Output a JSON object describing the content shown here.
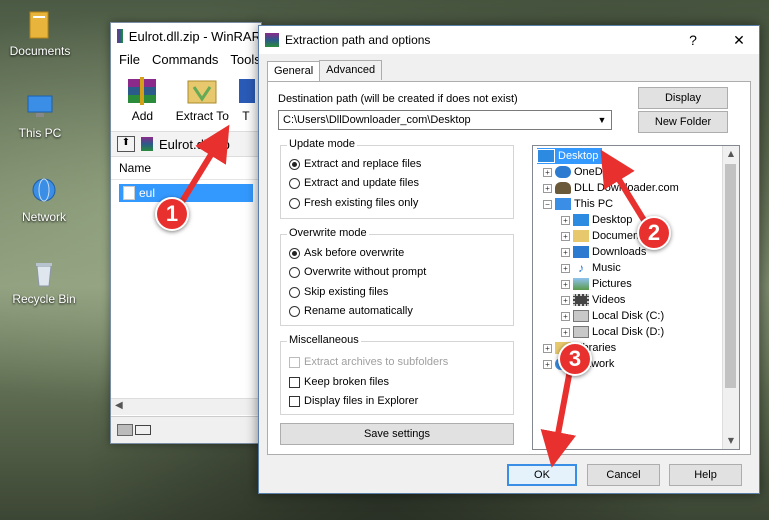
{
  "desktop": {
    "icons": [
      {
        "label": "Documents"
      },
      {
        "label": "This PC"
      },
      {
        "label": "Network"
      },
      {
        "label": "Recycle Bin"
      }
    ]
  },
  "winrar": {
    "title": "Eulrot.dll.zip - WinRAR",
    "menu": [
      "File",
      "Commands",
      "Tools"
    ],
    "toolbar": {
      "add": "Add",
      "extract_to": "Extract To",
      "test": "T"
    },
    "path": "Eulrot.dll.zip",
    "column_name": "Name",
    "row_file": "eul"
  },
  "dialog": {
    "title": "Extraction path and options",
    "help_glyph": "?",
    "close_glyph": "✕",
    "tabs": [
      "General",
      "Advanced"
    ],
    "dest_label": "Destination path (will be created if does not exist)",
    "dest_value": "C:\\Users\\DllDownloader_com\\Desktop",
    "display_button": "Display",
    "new_folder_button": "New Folder",
    "update_mode": {
      "title": "Update mode",
      "options": [
        "Extract and replace files",
        "Extract and update files",
        "Fresh existing files only"
      ],
      "selected": 0
    },
    "overwrite_mode": {
      "title": "Overwrite mode",
      "options": [
        "Ask before overwrite",
        "Overwrite without prompt",
        "Skip existing files",
        "Rename automatically"
      ],
      "selected": 0
    },
    "misc": {
      "title": "Miscellaneous",
      "options": [
        "Extract archives to subfolders",
        "Keep broken files",
        "Display files in Explorer"
      ]
    },
    "save_settings": "Save settings",
    "tree": [
      {
        "label": "Desktop",
        "selected": true
      },
      {
        "label": "OneDrive"
      },
      {
        "label": "DLL Downloader.com"
      },
      {
        "label": "This PC"
      },
      {
        "label": "Desktop"
      },
      {
        "label": "Documents"
      },
      {
        "label": "Downloads"
      },
      {
        "label": "Music"
      },
      {
        "label": "Pictures"
      },
      {
        "label": "Videos"
      },
      {
        "label": "Local Disk (C:)"
      },
      {
        "label": "Local Disk (D:)"
      },
      {
        "label": "Libraries"
      },
      {
        "label": "Network"
      }
    ],
    "ok": "OK",
    "cancel": "Cancel",
    "help": "Help"
  },
  "annotations": {
    "step1": "1",
    "step2": "2",
    "step3": "3",
    "color": "#e8312f"
  }
}
